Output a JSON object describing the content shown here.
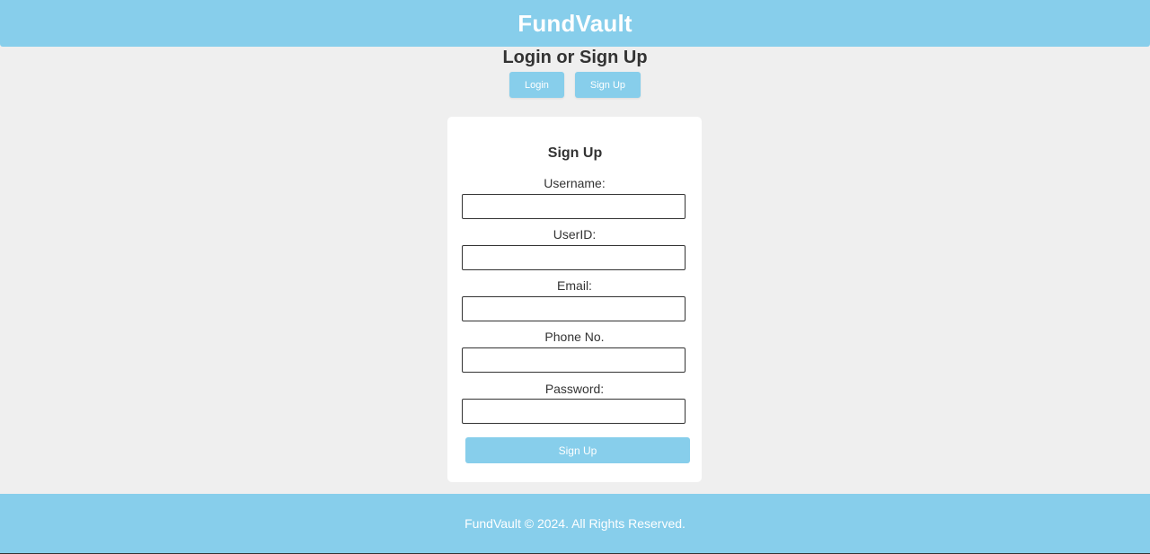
{
  "header": {
    "brand": "FundVault"
  },
  "main": {
    "title": "Login or Sign Up",
    "mode_buttons": [
      {
        "label": "Login"
      },
      {
        "label": "Sign Up"
      }
    ]
  },
  "signup_form": {
    "title": "Sign Up",
    "fields": [
      {
        "label": "Username:",
        "value": "",
        "placeholder": ""
      },
      {
        "label": "UserID:",
        "value": "",
        "placeholder": ""
      },
      {
        "label": "Email:",
        "value": "",
        "placeholder": ""
      },
      {
        "label": "Phone No.",
        "value": "",
        "placeholder": ""
      },
      {
        "label": "Password:",
        "value": "",
        "placeholder": ""
      }
    ],
    "submit_label": "Sign Up"
  },
  "footer": {
    "text": "FundVault © 2024. All Rights Reserved."
  },
  "colors": {
    "accent": "#87ceeb",
    "background": "#efefef",
    "card": "#ffffff",
    "text": "#333333"
  }
}
